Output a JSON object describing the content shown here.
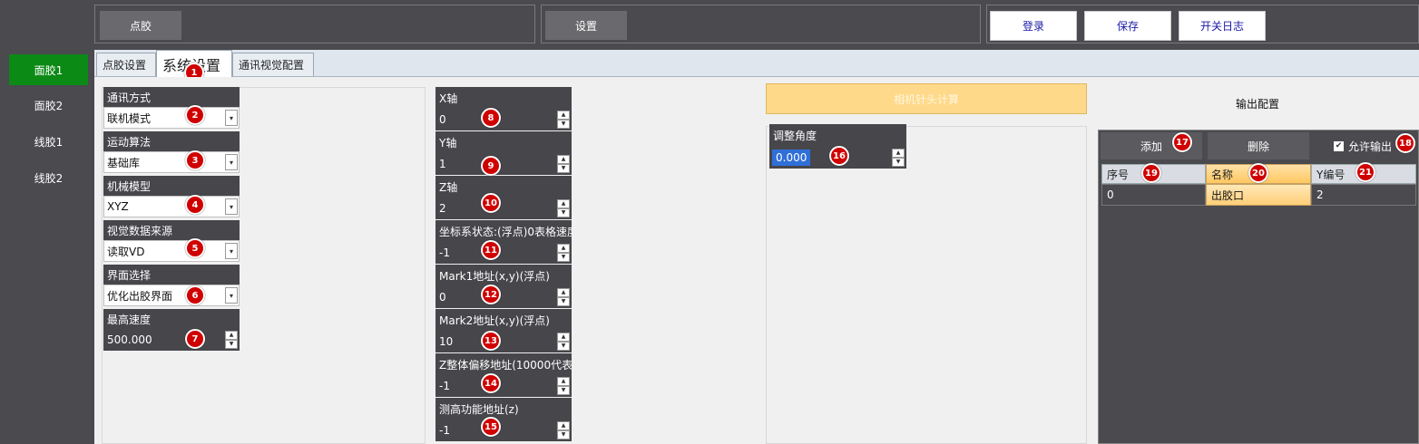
{
  "top": {
    "dispense_btn": "点胶",
    "settings_btn": "设置",
    "login_btn": "登录",
    "save_btn": "保存",
    "log_btn": "开关日志"
  },
  "sidebar": {
    "items": [
      {
        "label": "面胶1",
        "active": true
      },
      {
        "label": "面胶2",
        "active": false
      },
      {
        "label": "线胶1",
        "active": false
      },
      {
        "label": "线胶2",
        "active": false
      }
    ]
  },
  "tabs": [
    {
      "label": "点胶设置"
    },
    {
      "label": "系统设置",
      "active": true
    },
    {
      "label": "通讯视觉配置"
    }
  ],
  "left_fields": [
    {
      "label": "通讯方式",
      "value": "联机模式",
      "kind": "dropdown",
      "marker": "2"
    },
    {
      "label": "运动算法",
      "value": "基础库",
      "kind": "dropdown",
      "marker": "3"
    },
    {
      "label": "机械模型",
      "value": "XYZ",
      "kind": "dropdown",
      "marker": "4"
    },
    {
      "label": "视觉数据来源",
      "value": "读取VD",
      "kind": "dropdown",
      "marker": "5"
    },
    {
      "label": "界面选择",
      "value": "优化出胶界面",
      "kind": "dropdown",
      "marker": "6"
    },
    {
      "label": "最高速度",
      "value": "500.000",
      "kind": "spin",
      "marker": "7"
    }
  ],
  "mid_fields": [
    {
      "label": "X轴",
      "value": "0",
      "marker": "8"
    },
    {
      "label": "Y轴",
      "value": "1",
      "marker": "9"
    },
    {
      "label": "Z轴",
      "value": "2",
      "marker": "10"
    },
    {
      "label": "坐标系状态:(浮点)0表格速度",
      "value": "-1",
      "marker": "11"
    },
    {
      "label": "Mark1地址(x,y)(浮点)",
      "value": "0",
      "marker": "12"
    },
    {
      "label": "Mark2地址(x,y)(浮点)",
      "value": "10",
      "marker": "13"
    },
    {
      "label": "Z整体偏移地址(10000代表",
      "value": "-1",
      "marker": "14"
    },
    {
      "label": "测高功能地址(z)",
      "value": "-1",
      "marker": "15"
    }
  ],
  "camera": {
    "calc_btn": "相机针头计算",
    "angle_label": "调整角度",
    "angle_value": "0.000",
    "angle_marker": "16"
  },
  "output": {
    "title": "输出配置",
    "add_btn": "添加",
    "add_marker": "17",
    "delete_btn": "删除",
    "allow_label": "允许输出",
    "allow_checked": true,
    "allow_marker": "18",
    "columns": [
      {
        "label": "序号",
        "marker": "19"
      },
      {
        "label": "名称",
        "marker": "20"
      },
      {
        "label": "Y编号",
        "marker": "21"
      }
    ],
    "rows": [
      [
        "0",
        "出胶口",
        "2"
      ]
    ]
  },
  "tab_marker": "1",
  "colors": {
    "sidebar_active": "#0c8a16",
    "label_bg": "#46464b",
    "marker_red": "#d00000",
    "calc_btn": "#ffd98a",
    "login_text": "#1a1aa6"
  }
}
